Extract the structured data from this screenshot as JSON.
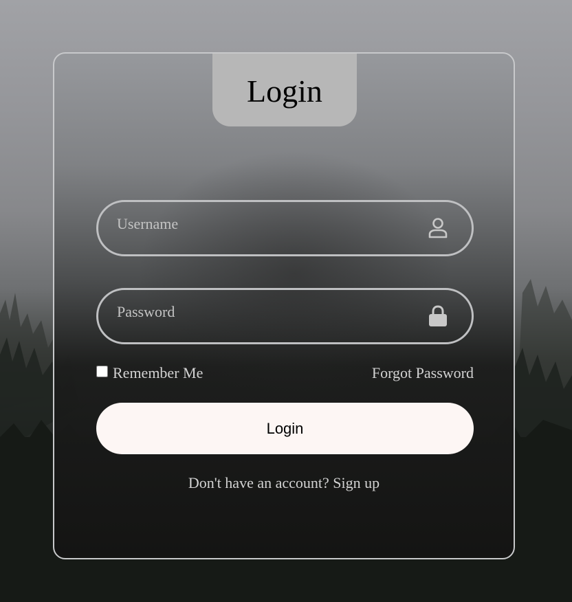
{
  "form": {
    "title": "Login",
    "username_placeholder": "Username",
    "password_placeholder": "Password",
    "remember_label": "Remember Me",
    "remember_checked": false,
    "forgot_label": "Forgot Password",
    "submit_label": "Login",
    "signup_prompt": "Don't have an account?",
    "signup_link": "Sign up"
  },
  "icons": {
    "username": "user-icon",
    "password": "lock-icon"
  },
  "colors": {
    "button_bg": "#fdf6f4",
    "tab_bg": "#b7b7b7",
    "border": "#c8c9cb"
  }
}
